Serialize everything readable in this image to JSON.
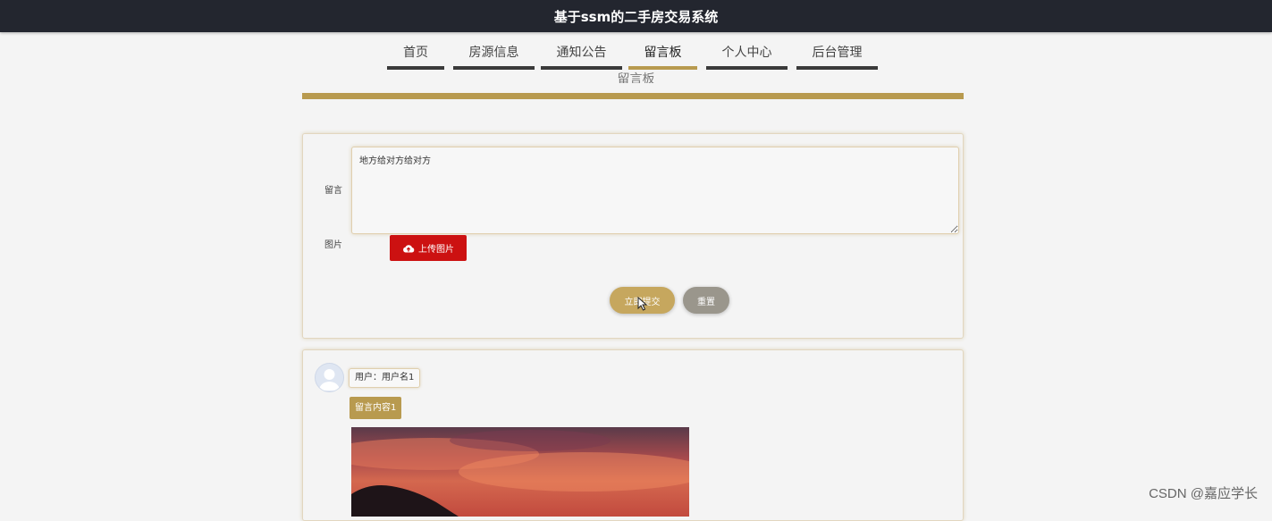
{
  "header": {
    "title": "基于ssm的二手房交易系统"
  },
  "nav": {
    "items": [
      {
        "label": "首页"
      },
      {
        "label": "房源信息"
      },
      {
        "label": "通知公告"
      },
      {
        "label": "留言板"
      },
      {
        "label": "个人中心"
      },
      {
        "label": "后台管理"
      }
    ],
    "active_index": 3
  },
  "section": {
    "title": "留言板"
  },
  "form": {
    "message_label": "留言",
    "message_value": "地方给对方给对方",
    "image_label": "图片",
    "upload_label": "上传图片",
    "submit_label": "立即提交",
    "reset_label": "重置"
  },
  "messages": [
    {
      "user": "用户：用户名1",
      "content": "留言内容1"
    }
  ],
  "watermark": "CSDN @嘉应学长",
  "colors": {
    "accent": "#b89a4f",
    "header_bg": "#23262f",
    "upload_red": "#cc1111"
  },
  "icons": {
    "upload": "cloud-upload-icon",
    "avatar": "user-avatar-icon",
    "cursor": "mouse-cursor-icon"
  }
}
